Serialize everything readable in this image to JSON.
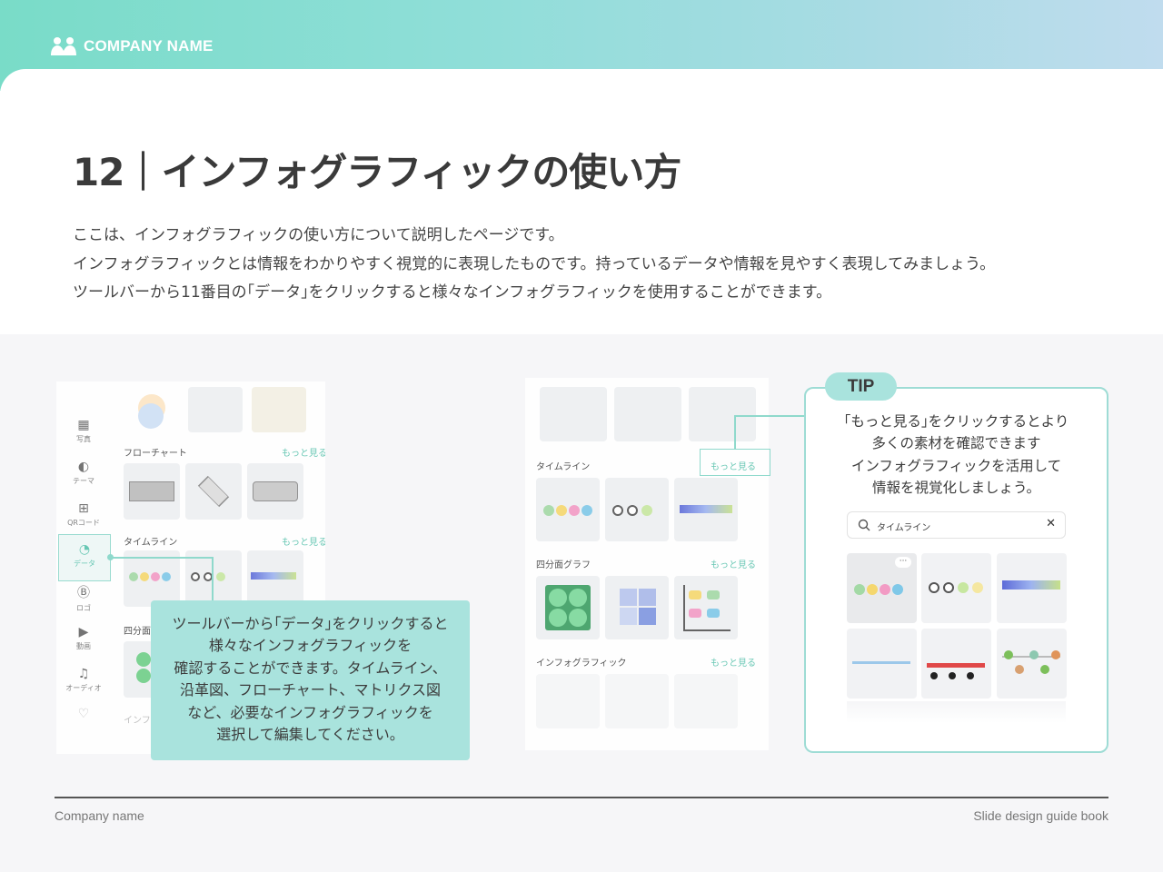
{
  "header": {
    "logo_icon": "people-icon",
    "company": "COMPANY NAME",
    "gradient": [
      "#79dcc8",
      "#c0dcee"
    ]
  },
  "title": "12｜インフォグラフィックの使い方",
  "description": [
    "ここは、インフォグラフィックの使い方について説明したページです。",
    "インフォグラフィックとは情報をわかりやすく視覚的に表現したものです。持っているデータや情報を見やすく表現してみましょう。",
    "ツールバーから11番目の｢データ｣をクリックすると様々なインフォグラフィックを使用することができます。"
  ],
  "screenshot_left": {
    "sidebar": [
      {
        "icon": "template-icon",
        "label": "写真"
      },
      {
        "icon": "palette-icon",
        "label": "テーマ"
      },
      {
        "icon": "qr-icon",
        "label": "QRコード"
      },
      {
        "icon": "data-icon",
        "label": "データ"
      },
      {
        "icon": "logo-icon",
        "label": "ロゴ"
      },
      {
        "icon": "play-icon",
        "label": "動画"
      },
      {
        "icon": "music-icon",
        "label": "オーディオ"
      },
      {
        "icon": "heart-icon",
        "label": ""
      }
    ],
    "sections": [
      {
        "label": "フローチャート",
        "more": "もっと見る"
      },
      {
        "label": "タイムライン",
        "more": "もっと見る"
      },
      {
        "label": "四分面グラフ",
        "more": ""
      },
      {
        "label": "インフ",
        "more": ""
      }
    ]
  },
  "callout": [
    "ツールバーから｢データ｣をクリックすると",
    "様々なインフォグラフィックを",
    "確認することができます。タイムライン、",
    "沿革図、フローチャート、マトリクス図",
    "など、必要なインフォグラフィックを",
    "選択して編集してください。"
  ],
  "screenshot_right": {
    "sections": [
      {
        "label": "タイムライン",
        "more": "もっと見る"
      },
      {
        "label": "四分面グラフ",
        "more": "もっと見る"
      },
      {
        "label": "インフォグラフィック",
        "more": "もっと見る"
      }
    ]
  },
  "tip": {
    "tag": "TIP",
    "text": [
      "｢もっと見る｣をクリックするとより",
      "多くの素材を確認できます",
      "インフォグラフィックを活用して",
      "情報を視覚化しましょう。"
    ],
    "search_value": "タイムライン",
    "search_icon": "search-icon",
    "clear_icon": "close-icon"
  },
  "footer": {
    "left": "Company name",
    "right": "Slide design guide book"
  }
}
